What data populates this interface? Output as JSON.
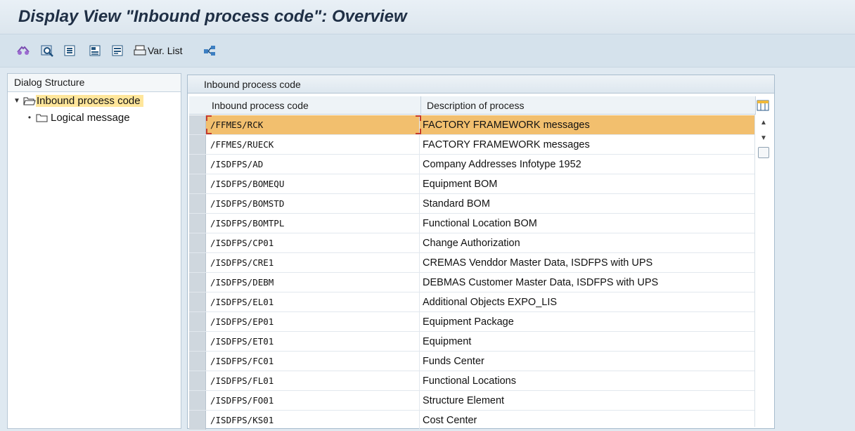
{
  "window": {
    "title": "Display View \"Inbound process code\": Overview"
  },
  "toolbar": {
    "var_list_label": "Var. List"
  },
  "icons": [
    "glasses-icon",
    "find-icon",
    "details-icon",
    "select-all-icon",
    "deselect-all-icon",
    "print-icon",
    "transport-icon",
    "table-settings-icon",
    "scroll-up-icon",
    "scroll-down-icon"
  ],
  "dialog_structure": {
    "header": "Dialog Structure",
    "items": [
      {
        "label": "Inbound process code",
        "expanded": true,
        "selected": true
      },
      {
        "label": "Logical message",
        "expanded": false,
        "selected": false
      }
    ]
  },
  "table": {
    "title": "Inbound process code",
    "columns": [
      "Inbound process code",
      "Description of process"
    ],
    "rows": [
      {
        "code": "/FFMES/RCK",
        "description": "FACTORY FRAMEWORK messages",
        "highlighted": true
      },
      {
        "code": "/FFMES/RUECK",
        "description": "FACTORY FRAMEWORK messages"
      },
      {
        "code": "/ISDFPS/AD",
        "description": "Company Addresses Infotype 1952"
      },
      {
        "code": "/ISDFPS/BOMEQU",
        "description": "Equipment BOM"
      },
      {
        "code": "/ISDFPS/BOMSTD",
        "description": "Standard BOM"
      },
      {
        "code": "/ISDFPS/BOMTPL",
        "description": "Functional Location BOM"
      },
      {
        "code": "/ISDFPS/CP01",
        "description": "Change Authorization"
      },
      {
        "code": "/ISDFPS/CRE1",
        "description": "CREMAS  Venddor Master Data, ISDFPS with UPS"
      },
      {
        "code": "/ISDFPS/DEBM",
        "description": "DEBMAS Customer Master Data, ISDFPS with UPS"
      },
      {
        "code": "/ISDFPS/EL01",
        "description": "Additional Objects EXPO_LIS"
      },
      {
        "code": "/ISDFPS/EP01",
        "description": "Equipment Package"
      },
      {
        "code": "/ISDFPS/ET01",
        "description": "Equipment"
      },
      {
        "code": "/ISDFPS/FC01",
        "description": "Funds Center"
      },
      {
        "code": "/ISDFPS/FL01",
        "description": "Functional Locations"
      },
      {
        "code": "/ISDFPS/FO01",
        "description": "Structure Element"
      },
      {
        "code": "/ISDFPS/KS01",
        "description": "Cost Center"
      }
    ]
  },
  "colors": {
    "highlight_row": "#f2bf6e",
    "tree_selected": "#ffe69b",
    "background": "#dfe9f1"
  }
}
